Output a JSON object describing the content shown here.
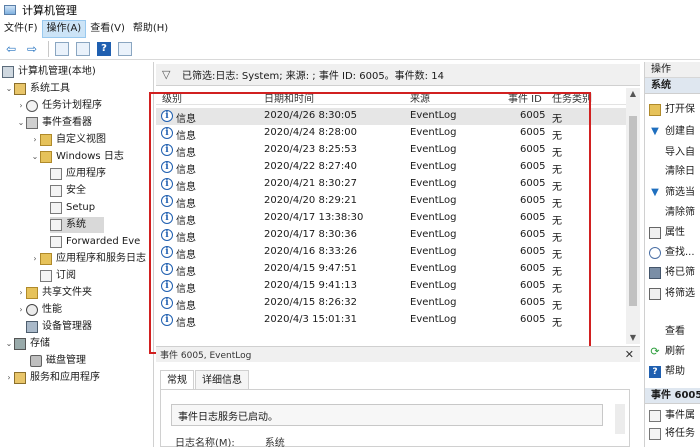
{
  "window": {
    "title": "计算机管理"
  },
  "menu": [
    {
      "label": "文件(F)",
      "active": false
    },
    {
      "label": "操作(A)",
      "active": true
    },
    {
      "label": "查看(V)",
      "active": false
    },
    {
      "label": "帮助(H)",
      "active": false
    }
  ],
  "tree": {
    "root": "计算机管理(本地)",
    "system_tools": "系统工具",
    "task_scheduler": "任务计划程序",
    "event_viewer": "事件查看器",
    "custom_views": "自定义视图",
    "windows_logs": "Windows 日志",
    "application": "应用程序",
    "security": "安全",
    "setup": "Setup",
    "system": "系统",
    "forwarded": "Forwarded Eve",
    "apps_services": "应用程序和服务日志",
    "subscriptions": "订阅",
    "shared_folders": "共享文件夹",
    "performance": "性能",
    "device_manager": "设备管理器",
    "storage": "存储",
    "disk_management": "磁盘管理",
    "services_apps": "服务和应用程序"
  },
  "filter": {
    "text": "已筛选:日志: System; 来源: ; 事件 ID: 6005。事件数: 14"
  },
  "grid": {
    "headers": {
      "level": "级别",
      "datetime": "日期和时间",
      "source": "来源",
      "event_id": "事件 ID",
      "category": "任务类别"
    },
    "rows": [
      {
        "level": "信息",
        "datetime": "2020/4/26 8:30:05",
        "source": "EventLog",
        "event_id": "6005",
        "category": "无"
      },
      {
        "level": "信息",
        "datetime": "2020/4/24 8:28:00",
        "source": "EventLog",
        "event_id": "6005",
        "category": "无"
      },
      {
        "level": "信息",
        "datetime": "2020/4/23 8:25:53",
        "source": "EventLog",
        "event_id": "6005",
        "category": "无"
      },
      {
        "level": "信息",
        "datetime": "2020/4/22 8:27:40",
        "source": "EventLog",
        "event_id": "6005",
        "category": "无"
      },
      {
        "level": "信息",
        "datetime": "2020/4/21 8:30:27",
        "source": "EventLog",
        "event_id": "6005",
        "category": "无"
      },
      {
        "level": "信息",
        "datetime": "2020/4/20 8:29:21",
        "source": "EventLog",
        "event_id": "6005",
        "category": "无"
      },
      {
        "level": "信息",
        "datetime": "2020/4/17 13:38:30",
        "source": "EventLog",
        "event_id": "6005",
        "category": "无"
      },
      {
        "level": "信息",
        "datetime": "2020/4/17 8:30:36",
        "source": "EventLog",
        "event_id": "6005",
        "category": "无"
      },
      {
        "level": "信息",
        "datetime": "2020/4/16 8:33:26",
        "source": "EventLog",
        "event_id": "6005",
        "category": "无"
      },
      {
        "level": "信息",
        "datetime": "2020/4/15 9:47:51",
        "source": "EventLog",
        "event_id": "6005",
        "category": "无"
      },
      {
        "level": "信息",
        "datetime": "2020/4/15 9:41:13",
        "source": "EventLog",
        "event_id": "6005",
        "category": "无"
      },
      {
        "level": "信息",
        "datetime": "2020/4/15 8:26:32",
        "source": "EventLog",
        "event_id": "6005",
        "category": "无"
      },
      {
        "level": "信息",
        "datetime": "2020/4/3 15:01:31",
        "source": "EventLog",
        "event_id": "6005",
        "category": "无"
      }
    ]
  },
  "detail": {
    "header": "事件 6005, EventLog",
    "tab_general": "常规",
    "tab_details": "详细信息",
    "description": "事件日志服务已启动。",
    "log_name_label": "日志名称(M):",
    "log_name_value": "系统"
  },
  "actions": {
    "header": "操作",
    "section_system": "系统",
    "open": "打开保",
    "create": "创建自",
    "import": "导入自",
    "clear": "清除日",
    "filter": "筛选当",
    "clear_filter": "清除筛",
    "properties": "属性",
    "find": "查找...",
    "save_all": "将已筛",
    "save_filter": "将筛选",
    "view": "查看",
    "refresh": "刷新",
    "help": "帮助",
    "section_event": "事件 6005",
    "event_props": "事件属",
    "attach_task": "将任务"
  }
}
